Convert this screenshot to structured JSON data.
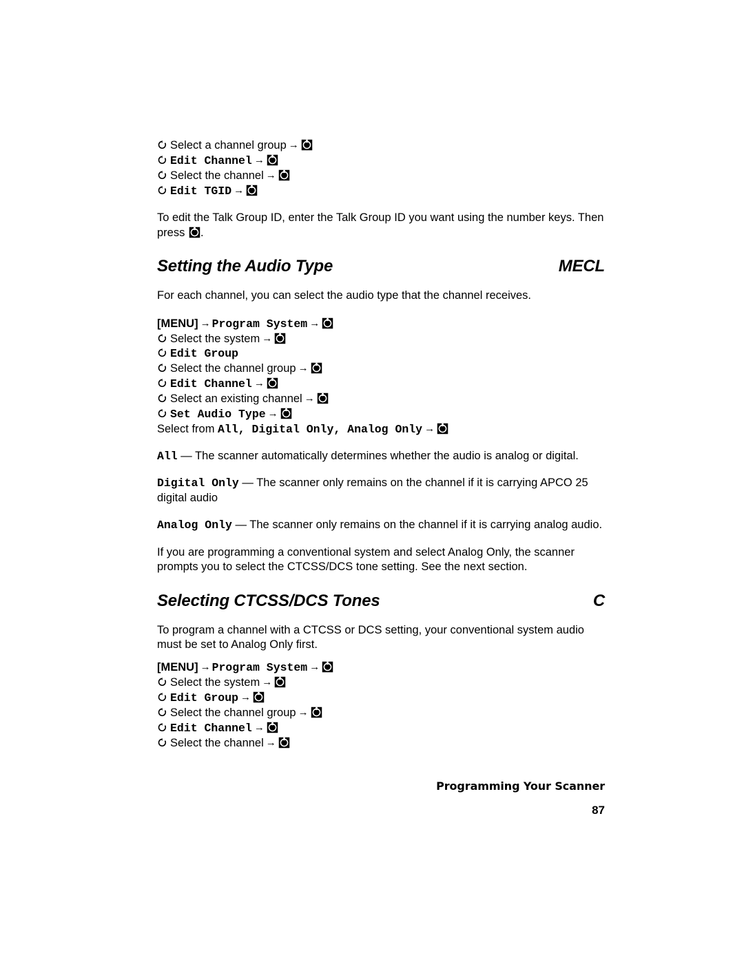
{
  "page": {
    "number": "87",
    "footer_title": "Programming Your Scanner"
  },
  "top_steps": [
    {
      "icon": "rotate-knob-icon",
      "text": "Select a channel group",
      "mono": false,
      "arrow": "→",
      "end_icon": "e-knob-icon"
    },
    {
      "icon": "rotate-knob-icon",
      "text": "Edit Channel",
      "mono": true,
      "arrow": "→",
      "end_icon": "e-knob-icon"
    },
    {
      "icon": "rotate-knob-icon",
      "text": "Select the channel",
      "mono": false,
      "arrow": "→",
      "end_icon": "e-knob-icon"
    },
    {
      "icon": "rotate-knob-icon",
      "text": "Edit TGID",
      "mono": true,
      "arrow": "→",
      "end_icon": "e-knob-icon"
    }
  ],
  "tgid_paragraph": {
    "part1": "To edit the Talk Group ID, enter the Talk Group ID you want using the number keys. Then press",
    "part2": "."
  },
  "audio_section": {
    "heading": "Setting the Audio Type",
    "tag": "MECL",
    "intro": "For each channel, you can select the audio type that the channel receives.",
    "steps": [
      {
        "icon": "none",
        "bracket": "[MENU]",
        "arrow1": "→",
        "text": "Program System",
        "mono": true,
        "arrow2": "→",
        "end_icon": "e-knob-icon"
      },
      {
        "icon": "rotate-knob-icon",
        "text": "Select the system",
        "mono": false,
        "arrow2": "→",
        "end_icon": "e-knob-icon"
      },
      {
        "icon": "rotate-knob-icon",
        "text": "Edit Group",
        "mono": true,
        "arrow2": "",
        "end_icon": "none"
      },
      {
        "icon": "rotate-knob-icon",
        "text": "Select the channel group",
        "mono": false,
        "arrow2": "→",
        "end_icon": "e-knob-icon"
      },
      {
        "icon": "rotate-knob-icon",
        "text": "Edit Channel",
        "mono": true,
        "arrow2": "→",
        "end_icon": "e-knob-icon"
      },
      {
        "icon": "rotate-knob-icon",
        "text": "Select an existing channel",
        "mono": false,
        "arrow2": "→",
        "end_icon": "e-knob-icon"
      },
      {
        "icon": "rotate-knob-icon",
        "text": "Set Audio Type",
        "mono": true,
        "arrow2": "→",
        "end_icon": "e-knob-icon"
      }
    ],
    "select_from": {
      "prefix": "Select from ",
      "options": "All, Digital Only, Analog Only",
      "arrow": "→",
      "end_icon": "e-knob-icon"
    },
    "definitions": [
      {
        "term": "All",
        "dash": " — ",
        "text": "The scanner automatically determines whether the audio is analog or digital."
      },
      {
        "term": "Digital Only",
        "dash": " — ",
        "text": "The scanner only remains on the channel if it is carrying APCO 25 digital audio"
      },
      {
        "term": "Analog Only",
        "dash": " — ",
        "text": "The scanner only remains on the channel if it is carrying analog audio."
      }
    ],
    "closing": "If you are programming a conventional system and select Analog Only, the scanner prompts you to select the CTCSS/DCS tone setting. See the next section."
  },
  "ctcss_section": {
    "heading": "Selecting CTCSS/DCS Tones",
    "tag": "C",
    "intro": "To program a channel with a CTCSS or DCS setting, your conventional system audio must be set to Analog Only first.",
    "steps": [
      {
        "icon": "none",
        "bracket": "[MENU]",
        "arrow1": "→",
        "text": "Program System",
        "mono": true,
        "arrow2": "→",
        "end_icon": "e-knob-icon"
      },
      {
        "icon": "rotate-knob-icon",
        "text": "Select the system",
        "mono": false,
        "arrow2": "→",
        "end_icon": "e-knob-icon"
      },
      {
        "icon": "rotate-knob-icon",
        "text": "Edit Group",
        "mono": true,
        "arrow2": "→",
        "end_icon": "e-knob-icon"
      },
      {
        "icon": "rotate-knob-icon",
        "text": "Select the channel group",
        "mono": false,
        "arrow2": "→",
        "end_icon": "e-knob-icon"
      },
      {
        "icon": "rotate-knob-icon",
        "text": "Edit Channel",
        "mono": true,
        "arrow2": "→",
        "end_icon": "e-knob-icon"
      },
      {
        "icon": "rotate-knob-icon",
        "text": "Select the channel",
        "mono": false,
        "arrow2": "→",
        "end_icon": "e-knob-icon"
      }
    ]
  }
}
